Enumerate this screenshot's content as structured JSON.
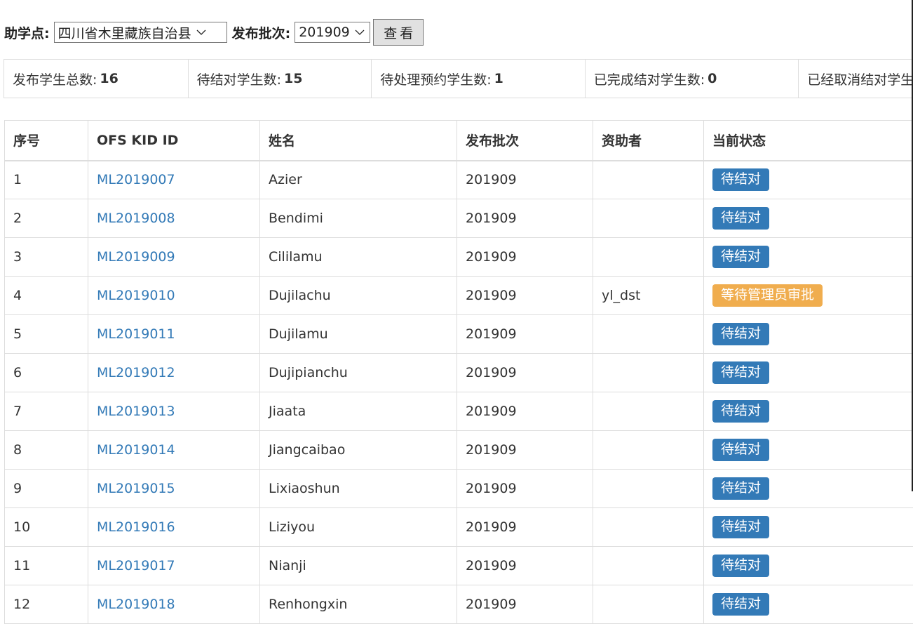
{
  "filters": {
    "site_label": "助学点:",
    "site_value": "四川省木里藏族自治县",
    "batch_label": "发布批次:",
    "batch_value": "201909",
    "view_button": "查看"
  },
  "stats": [
    {
      "label": "发布学生总数:",
      "value": "16"
    },
    {
      "label": "待结对学生数:",
      "value": "15"
    },
    {
      "label": "待处理预约学生数:",
      "value": "1"
    },
    {
      "label": "已完成结对学生数:",
      "value": "0"
    },
    {
      "label": "已经取消结对学生数:",
      "value": ""
    }
  ],
  "table": {
    "headers": [
      "序号",
      "OFS KID ID",
      "姓名",
      "发布批次",
      "资助者",
      "当前状态"
    ],
    "rows": [
      {
        "no": "1",
        "kid_id": "ML2019007",
        "name": "Azier",
        "batch": "201909",
        "sponsor": "",
        "status": "待结对",
        "status_kind": "pending"
      },
      {
        "no": "2",
        "kid_id": "ML2019008",
        "name": "Bendimi",
        "batch": "201909",
        "sponsor": "",
        "status": "待结对",
        "status_kind": "pending"
      },
      {
        "no": "3",
        "kid_id": "ML2019009",
        "name": "Cililamu",
        "batch": "201909",
        "sponsor": "",
        "status": "待结对",
        "status_kind": "pending"
      },
      {
        "no": "4",
        "kid_id": "ML2019010",
        "name": "Dujilachu",
        "batch": "201909",
        "sponsor": "yl_dst",
        "status": "等待管理员审批",
        "status_kind": "awaiting"
      },
      {
        "no": "5",
        "kid_id": "ML2019011",
        "name": "Dujilamu",
        "batch": "201909",
        "sponsor": "",
        "status": "待结对",
        "status_kind": "pending"
      },
      {
        "no": "6",
        "kid_id": "ML2019012",
        "name": "Dujipianchu",
        "batch": "201909",
        "sponsor": "",
        "status": "待结对",
        "status_kind": "pending"
      },
      {
        "no": "7",
        "kid_id": "ML2019013",
        "name": "Jiaata",
        "batch": "201909",
        "sponsor": "",
        "status": "待结对",
        "status_kind": "pending"
      },
      {
        "no": "8",
        "kid_id": "ML2019014",
        "name": "Jiangcaibao",
        "batch": "201909",
        "sponsor": "",
        "status": "待结对",
        "status_kind": "pending"
      },
      {
        "no": "9",
        "kid_id": "ML2019015",
        "name": "Lixiaoshun",
        "batch": "201909",
        "sponsor": "",
        "status": "待结对",
        "status_kind": "pending"
      },
      {
        "no": "10",
        "kid_id": "ML2019016",
        "name": "Liziyou",
        "batch": "201909",
        "sponsor": "",
        "status": "待结对",
        "status_kind": "pending"
      },
      {
        "no": "11",
        "kid_id": "ML2019017",
        "name": "Nianji",
        "batch": "201909",
        "sponsor": "",
        "status": "待结对",
        "status_kind": "pending"
      },
      {
        "no": "12",
        "kid_id": "ML2019018",
        "name": "Renhongxin",
        "batch": "201909",
        "sponsor": "",
        "status": "待结对",
        "status_kind": "pending"
      }
    ]
  },
  "colors": {
    "link": "#337ab7",
    "badge_pending": "#337ab7",
    "badge_awaiting": "#f0ad4e",
    "border": "#dddddd"
  },
  "icons": {
    "select_arrow": "chevron-down-icon"
  }
}
